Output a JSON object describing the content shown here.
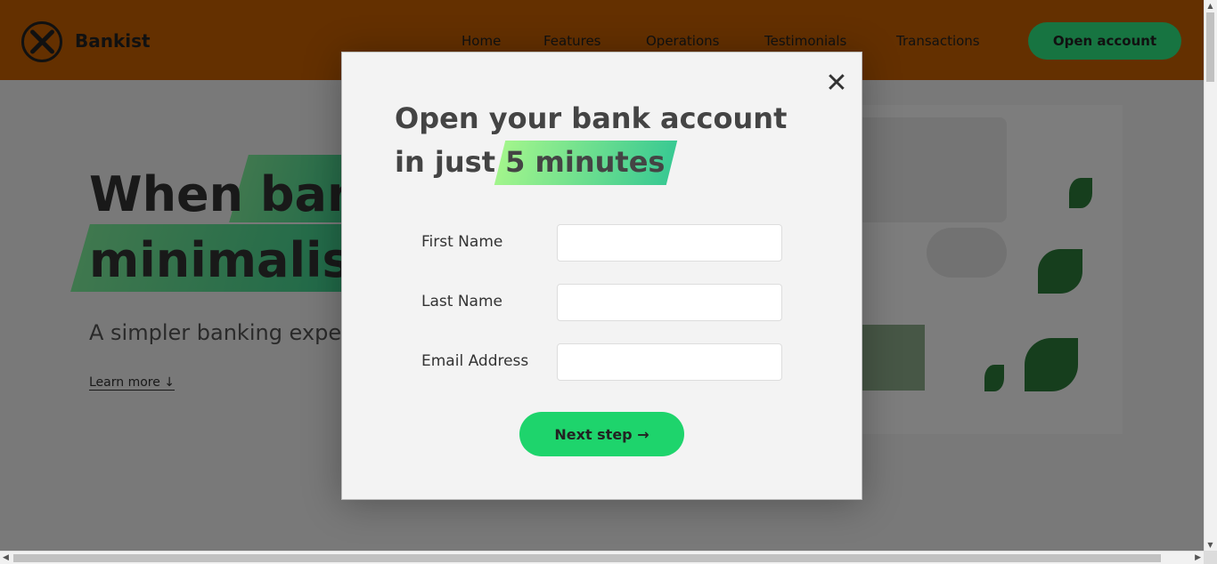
{
  "header": {
    "brand": "Bankist",
    "nav": [
      "Home",
      "Features",
      "Operations",
      "Testimonials",
      "Transactions"
    ],
    "open_button": "Open account"
  },
  "hero": {
    "title_line1_a": "When",
    "title_line1_b": "banking",
    "title_line2": "minimalist",
    "subtitle": "A simpler banking experience",
    "link": "Learn more ↓"
  },
  "modal": {
    "title_line1": "Open your bank account",
    "title_line2_prefix": "in just",
    "title_highlight": "5 minutes",
    "close_glyph": "✕",
    "fields": [
      {
        "label": "First Name",
        "value": ""
      },
      {
        "label": "Last Name",
        "value": ""
      },
      {
        "label": "Email Address",
        "value": ""
      }
    ],
    "submit": "Next step →"
  },
  "colors": {
    "header_bg": "#c96100",
    "accent_green": "#1ed46c",
    "highlight_gradient_start": "#a2f58c",
    "highlight_gradient_end": "#39c992"
  }
}
